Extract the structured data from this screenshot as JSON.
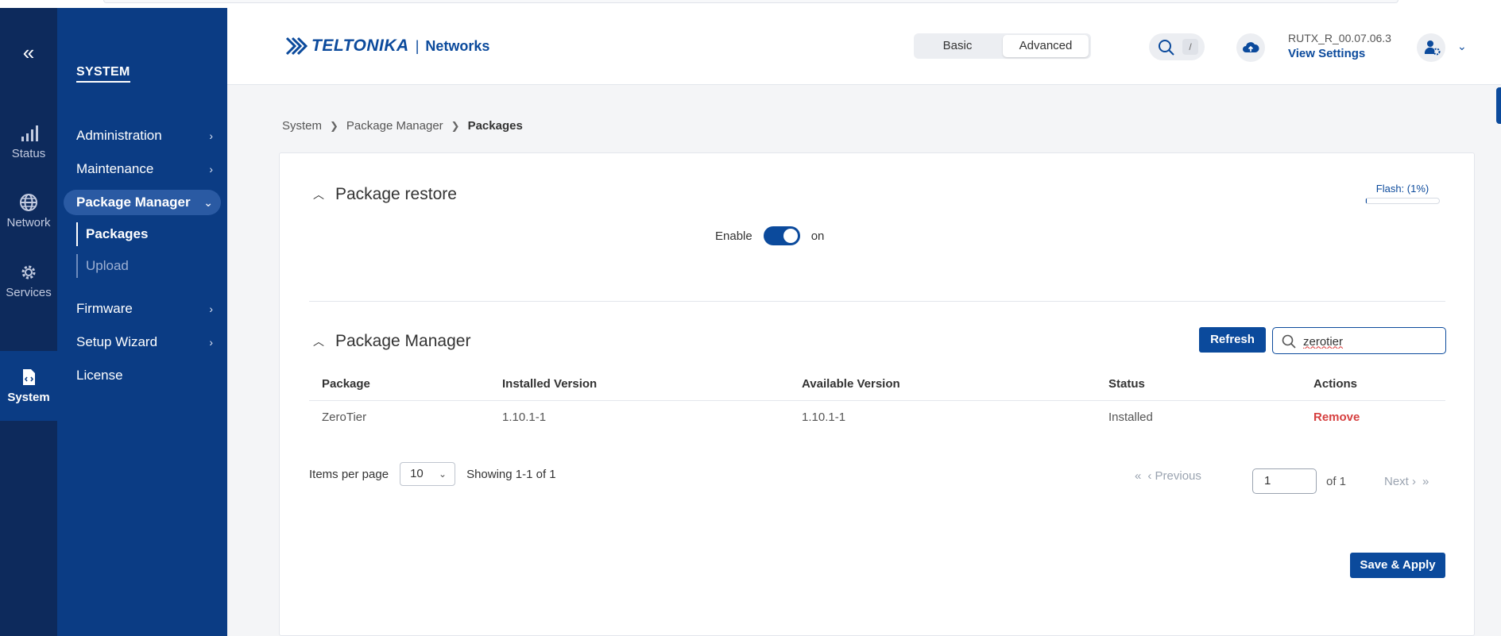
{
  "rail": {
    "items": [
      {
        "label": "Status"
      },
      {
        "label": "Network"
      },
      {
        "label": "Services"
      },
      {
        "label": "System"
      }
    ]
  },
  "sidebar": {
    "section_title": "SYSTEM",
    "items": [
      {
        "label": "Administration"
      },
      {
        "label": "Maintenance"
      },
      {
        "label": "Package Manager"
      },
      {
        "label": "Firmware"
      },
      {
        "label": "Setup Wizard"
      },
      {
        "label": "License"
      }
    ],
    "subitems": [
      {
        "label": "Packages"
      },
      {
        "label": "Upload"
      }
    ]
  },
  "header": {
    "brand": "TELTONIKA",
    "separator": "|",
    "networks": "Networks",
    "mode_basic": "Basic",
    "mode_advanced": "Advanced",
    "search_shortcut": "/",
    "firmware_version": "RUTX_R_00.07.06.3",
    "view_settings": "View Settings"
  },
  "breadcrumb": {
    "items": [
      "System",
      "Package Manager",
      "Packages"
    ]
  },
  "package_restore": {
    "title": "Package restore",
    "flash_label": "Flash: (1%)",
    "flash_percent": 1,
    "enable_label": "Enable",
    "enable_state": "on"
  },
  "package_manager": {
    "title": "Package Manager",
    "refresh_label": "Refresh",
    "search_value": "zerotier",
    "columns": [
      "Package",
      "Installed Version",
      "Available Version",
      "Status",
      "Actions"
    ],
    "rows": [
      {
        "package": "ZeroTier",
        "installed": "1.10.1-1",
        "available": "1.10.1-1",
        "status": "Installed",
        "action": "Remove"
      }
    ],
    "items_per_page_label": "Items per page",
    "items_per_page_value": "10",
    "showing": "Showing 1-1 of 1",
    "previous_label": "Previous",
    "next_label": "Next",
    "page_value": "1",
    "of_label": "of 1"
  },
  "footer": {
    "save_apply": "Save & Apply"
  },
  "colors": {
    "brand_blue": "#0b4a9c",
    "rail_bg": "#0d2a5c",
    "sidebar_bg": "#0b3c84",
    "remove_red": "#d64040"
  }
}
